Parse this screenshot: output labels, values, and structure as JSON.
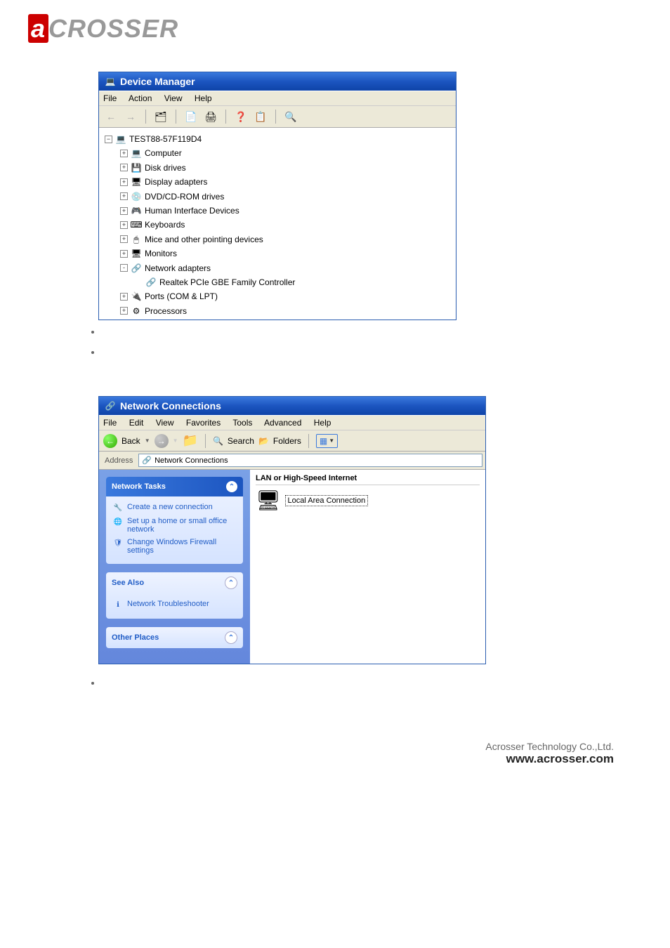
{
  "brand": "ACROSSER",
  "footer": {
    "company": "Acrosser Technology Co.,Ltd.",
    "url": "www.acrosser.com"
  },
  "device_manager": {
    "title": "Device Manager",
    "menu": [
      "File",
      "Action",
      "View",
      "Help"
    ],
    "root": "TEST88-57F119D4",
    "nodes": [
      {
        "label": "Computer",
        "exp": "+"
      },
      {
        "label": "Disk drives",
        "exp": "+"
      },
      {
        "label": "Display adapters",
        "exp": "+"
      },
      {
        "label": "DVD/CD-ROM drives",
        "exp": "+"
      },
      {
        "label": "Human Interface Devices",
        "exp": "+"
      },
      {
        "label": "Keyboards",
        "exp": "+"
      },
      {
        "label": "Mice and other pointing devices",
        "exp": "+"
      },
      {
        "label": "Monitors",
        "exp": "+"
      },
      {
        "label": "Network adapters",
        "exp": "-",
        "children": [
          {
            "label": "Realtek PCIe GBE Family Controller"
          }
        ]
      },
      {
        "label": "Ports (COM & LPT)",
        "exp": "+"
      },
      {
        "label": "Processors",
        "exp": "+"
      }
    ]
  },
  "network_connections": {
    "title": "Network Connections",
    "menu": [
      "File",
      "Edit",
      "View",
      "Favorites",
      "Tools",
      "Advanced",
      "Help"
    ],
    "toolbar": {
      "back": "Back",
      "search": "Search",
      "folders": "Folders"
    },
    "address_label": "Address",
    "address_value": "Network Connections",
    "task_panels": [
      {
        "header": "Network Tasks",
        "style": "blue",
        "links": [
          "Create a new connection",
          "Set up a home or small office network",
          "Change Windows Firewall settings"
        ]
      },
      {
        "header": "See Also",
        "style": "light",
        "links": [
          "Network Troubleshooter"
        ]
      },
      {
        "header": "Other Places",
        "style": "light",
        "links": []
      }
    ],
    "section_header": "LAN or High-Speed Internet",
    "connection_label": "Local Area Connection"
  }
}
